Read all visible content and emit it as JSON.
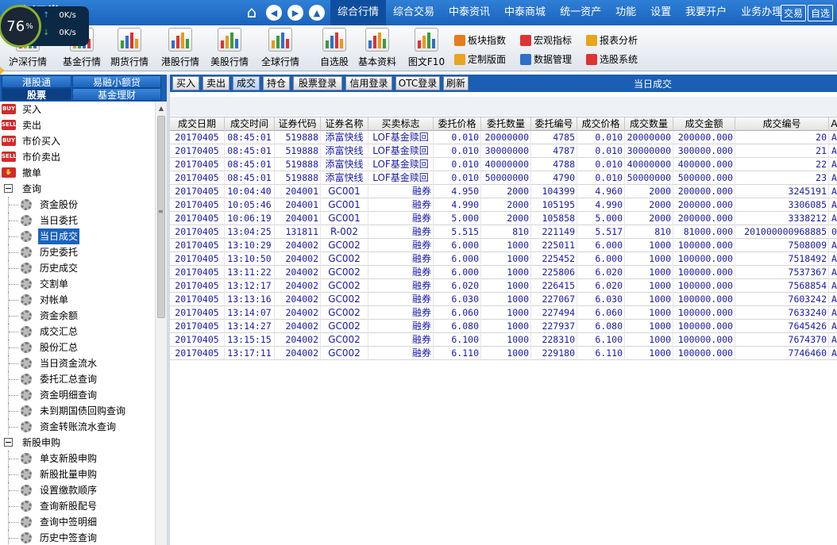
{
  "app": {
    "brand": "…泰证券",
    "nav_items": [
      "综合行情",
      "综合交易",
      "中泰资讯",
      "中泰商城",
      "统一资产",
      "功能",
      "设置",
      "我要开户",
      "业务办理"
    ],
    "nav_active_index": 0,
    "nav_right": [
      "交易",
      "自选"
    ]
  },
  "speed_widget": {
    "percent": "76",
    "percent_unit": "%",
    "up": "0K/s",
    "down": "0K/s"
  },
  "toolbar": {
    "tools": [
      {
        "label": "沪深行情",
        "icon": "market-shsz-icon"
      },
      {
        "label": "基金行情",
        "icon": "fund-quote-icon"
      },
      {
        "label": "期货行情",
        "icon": "futures-quote-icon"
      },
      {
        "label": "港股行情",
        "icon": "hk-quote-icon"
      },
      {
        "label": "美股行情",
        "icon": "us-quote-icon"
      },
      {
        "label": "全球行情",
        "icon": "global-quote-icon"
      },
      {
        "label": "自选股",
        "icon": "watchlist-icon"
      },
      {
        "label": "基本资料",
        "icon": "key-icon"
      },
      {
        "label": "图文F10",
        "icon": "f10-icon"
      }
    ],
    "tools2": [
      {
        "label": "板块指数",
        "icon": "sector-index-icon"
      },
      {
        "label": "宏观指标",
        "icon": "macro-icon"
      },
      {
        "label": "报表分析",
        "icon": "report-icon"
      },
      {
        "label": "定制版面",
        "icon": "layout-icon"
      },
      {
        "label": "数据管理",
        "icon": "data-manage-icon"
      },
      {
        "label": "选股系统",
        "icon": "stock-picker-icon"
      }
    ]
  },
  "left_tabs": {
    "hk": "港股通",
    "loan": "易融小额贷",
    "stock": "股票",
    "fund": "基金理财"
  },
  "tree": {
    "top_items": [
      {
        "badge": "BUY",
        "label": "买入",
        "color": "#d22a2a"
      },
      {
        "badge": "SELL",
        "label": "卖出",
        "color": "#d22a2a"
      },
      {
        "badge": "BUY",
        "label": "市价买入",
        "color": "#d22a2a"
      },
      {
        "badge": "SELL",
        "label": "市价卖出",
        "color": "#d22a2a"
      },
      {
        "badge": "",
        "label": "撤单",
        "color": "#d22a2a"
      }
    ],
    "group_query": "查询",
    "query_items": [
      "资金股份",
      "当日委托",
      "当日成交",
      "历史委托",
      "历史成交",
      "交割单",
      "对帐单",
      "资金余额",
      "成交汇总",
      "股份汇总",
      "当日资金流水",
      "委托汇总查询",
      "资金明细查询",
      "未到期国债回购查询",
      "资金转账流水查询"
    ],
    "selected_query_index": 2,
    "group_ipo": "新股申购",
    "ipo_items": [
      "单支新股申购",
      "新股批量申购",
      "设置缴款顺序",
      "查询新股配号",
      "查询中签明细",
      "历史中签查询"
    ]
  },
  "right": {
    "buttons": [
      "买入",
      "卖出",
      "成交",
      "持仓",
      "股票登录",
      "信用登录",
      "OTC登录",
      "刷新"
    ],
    "selected_button_index": 2,
    "title": "当日成交"
  },
  "table": {
    "columns": [
      "成交日期",
      "成交时间",
      "证券代码",
      "证券名称",
      "买卖标志",
      "委托价格",
      "委托数量",
      "委托编号",
      "成交价格",
      "成交数量",
      "成交金额",
      "成交编号",
      "A"
    ],
    "rows": [
      [
        "20170405",
        "08:45:01",
        "519888",
        "添富快线",
        "LOF基金赎回",
        "0.010",
        "20000000",
        "4785",
        "0.010",
        "20000000",
        "200000.000",
        "20",
        "A"
      ],
      [
        "20170405",
        "08:45:01",
        "519888",
        "添富快线",
        "LOF基金赎回",
        "0.010",
        "30000000",
        "4787",
        "0.010",
        "30000000",
        "300000.000",
        "21",
        "A"
      ],
      [
        "20170405",
        "08:45:01",
        "519888",
        "添富快线",
        "LOF基金赎回",
        "0.010",
        "40000000",
        "4788",
        "0.010",
        "40000000",
        "400000.000",
        "22",
        "A"
      ],
      [
        "20170405",
        "08:45:01",
        "519888",
        "添富快线",
        "LOF基金赎回",
        "0.010",
        "50000000",
        "4790",
        "0.010",
        "50000000",
        "500000.000",
        "23",
        "A"
      ],
      [
        "20170405",
        "10:04:40",
        "204001",
        "GC001",
        "融券",
        "4.950",
        "2000",
        "104399",
        "4.960",
        "2000",
        "200000.000",
        "3245191",
        "A"
      ],
      [
        "20170405",
        "10:05:46",
        "204001",
        "GC001",
        "融券",
        "4.990",
        "2000",
        "105195",
        "4.990",
        "2000",
        "200000.000",
        "3306085",
        "A"
      ],
      [
        "20170405",
        "10:06:19",
        "204001",
        "GC001",
        "融券",
        "5.000",
        "2000",
        "105858",
        "5.000",
        "2000",
        "200000.000",
        "3338212",
        "A"
      ],
      [
        "20170405",
        "13:04:25",
        "131811",
        "R-002",
        "融券",
        "5.515",
        "810",
        "221149",
        "5.517",
        "810",
        "81000.000",
        "201000000968885",
        "0"
      ],
      [
        "20170405",
        "13:10:29",
        "204002",
        "GC002",
        "融券",
        "6.000",
        "1000",
        "225011",
        "6.000",
        "1000",
        "100000.000",
        "7508009",
        "A"
      ],
      [
        "20170405",
        "13:10:50",
        "204002",
        "GC002",
        "融券",
        "6.000",
        "1000",
        "225452",
        "6.000",
        "1000",
        "100000.000",
        "7518492",
        "A"
      ],
      [
        "20170405",
        "13:11:22",
        "204002",
        "GC002",
        "融券",
        "6.000",
        "1000",
        "225806",
        "6.020",
        "1000",
        "100000.000",
        "7537367",
        "A"
      ],
      [
        "20170405",
        "13:12:17",
        "204002",
        "GC002",
        "融券",
        "6.020",
        "1000",
        "226415",
        "6.020",
        "1000",
        "100000.000",
        "7568854",
        "A"
      ],
      [
        "20170405",
        "13:13:16",
        "204002",
        "GC002",
        "融券",
        "6.030",
        "1000",
        "227067",
        "6.030",
        "1000",
        "100000.000",
        "7603242",
        "A"
      ],
      [
        "20170405",
        "13:14:07",
        "204002",
        "GC002",
        "融券",
        "6.060",
        "1000",
        "227494",
        "6.060",
        "1000",
        "100000.000",
        "7633240",
        "A"
      ],
      [
        "20170405",
        "13:14:27",
        "204002",
        "GC002",
        "融券",
        "6.080",
        "1000",
        "227937",
        "6.080",
        "1000",
        "100000.000",
        "7645426",
        "A"
      ],
      [
        "20170405",
        "13:15:15",
        "204002",
        "GC002",
        "融券",
        "6.100",
        "1000",
        "228310",
        "6.100",
        "1000",
        "100000.000",
        "7674370",
        "A"
      ],
      [
        "20170405",
        "13:17:11",
        "204002",
        "GC002",
        "融券",
        "6.110",
        "1000",
        "229180",
        "6.110",
        "1000",
        "100000.000",
        "7746460",
        "A"
      ]
    ]
  },
  "colors": {
    "header_blue": "#1a63bd",
    "table_text": "#1a1aa6",
    "selected_item_bg": "#1a63bd",
    "buy_sell_badge": "#d22a2a"
  }
}
